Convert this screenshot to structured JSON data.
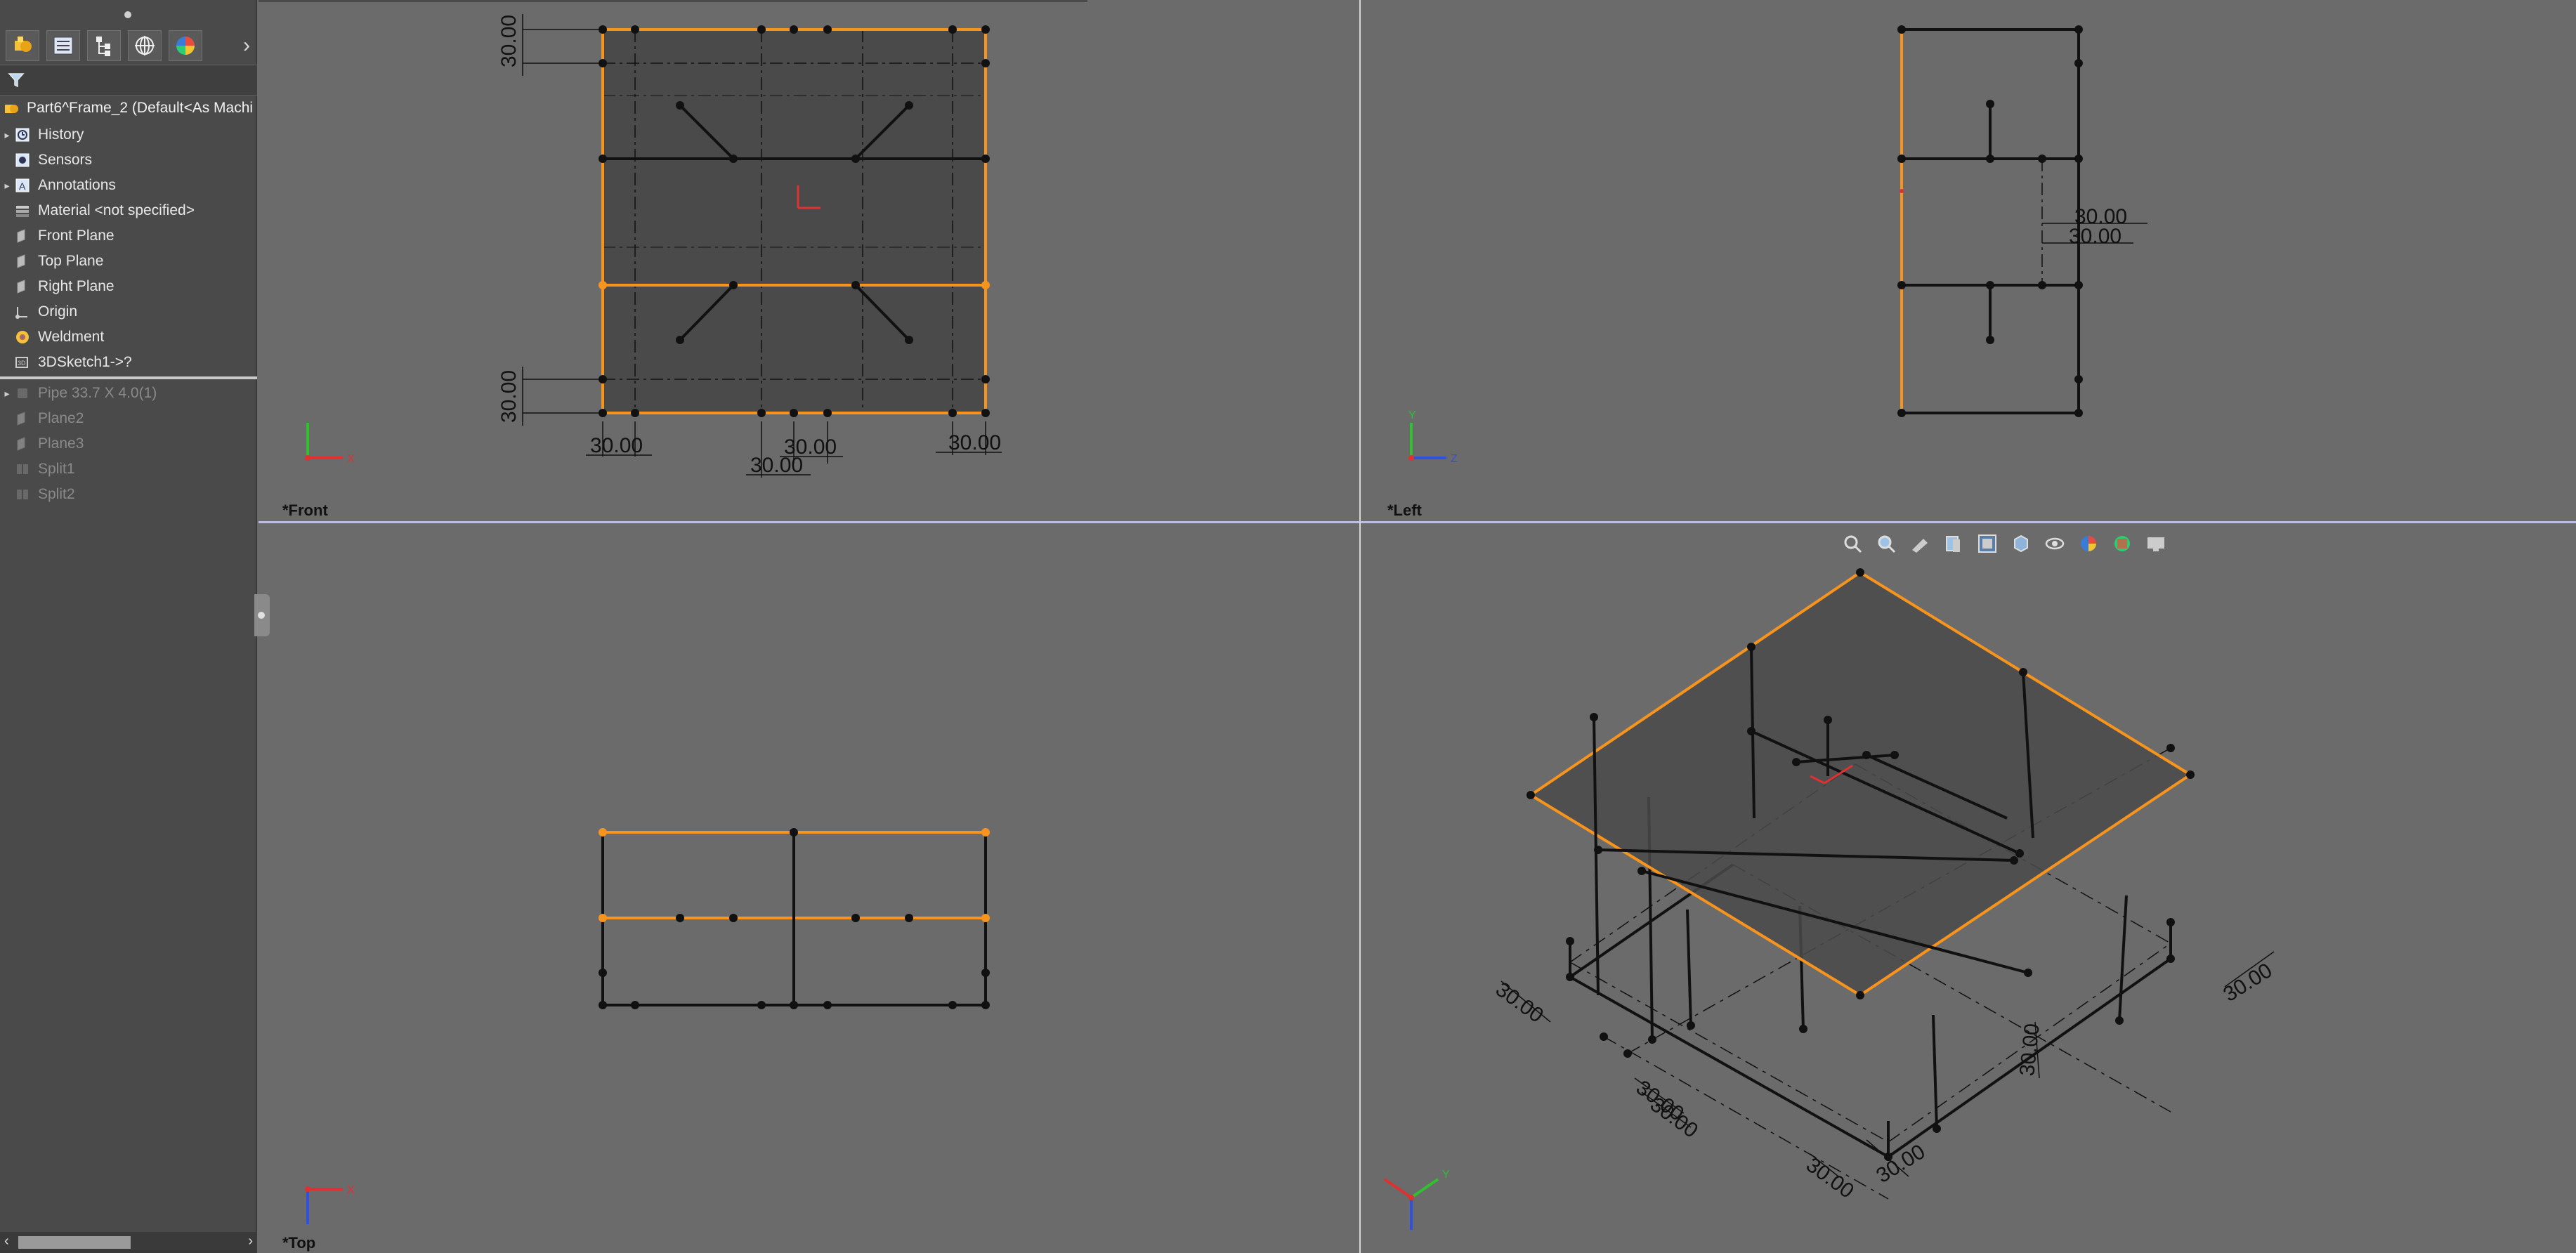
{
  "tree": {
    "root": "Part6^Frame_2  (Default<As Machi",
    "items": [
      {
        "label": "History",
        "expand": true,
        "icon": "history-icon"
      },
      {
        "label": "Sensors",
        "expand": false,
        "icon": "sensors-icon"
      },
      {
        "label": "Annotations",
        "expand": true,
        "icon": "annotations-icon"
      },
      {
        "label": "Material <not specified>",
        "expand": false,
        "icon": "material-icon"
      },
      {
        "label": "Front Plane",
        "expand": false,
        "icon": "plane-icon"
      },
      {
        "label": "Top Plane",
        "expand": false,
        "icon": "plane-icon"
      },
      {
        "label": "Right Plane",
        "expand": false,
        "icon": "plane-icon"
      },
      {
        "label": "Origin",
        "expand": false,
        "icon": "origin-icon"
      },
      {
        "label": "Weldment",
        "expand": false,
        "icon": "weldment-icon"
      },
      {
        "label": "3DSketch1->?",
        "expand": false,
        "icon": "sketch-icon"
      }
    ],
    "suppressed": [
      {
        "label": "Pipe 33.7 X 4.0(1)",
        "expand": true,
        "icon": "pipe-icon"
      },
      {
        "label": "Plane2",
        "expand": false,
        "icon": "plane-icon"
      },
      {
        "label": "Plane3",
        "expand": false,
        "icon": "plane-icon"
      },
      {
        "label": "Split1",
        "expand": false,
        "icon": "split-icon"
      },
      {
        "label": "Split2",
        "expand": false,
        "icon": "split-icon"
      }
    ]
  },
  "tabs": [
    "feature-manager-tab",
    "property-manager-tab",
    "configuration-manager-tab",
    "dimxpert-tab",
    "display-manager-tab"
  ],
  "viewports": {
    "front": {
      "label": "*Front"
    },
    "left": {
      "label": "*Left"
    },
    "top": {
      "label": "*Top"
    },
    "iso": {
      "label": ""
    }
  },
  "dims": {
    "d30": "30.00"
  },
  "axes": {
    "x": "X",
    "y": "Y",
    "z": "Z"
  },
  "colors": {
    "accent_orange": "#f7941d",
    "face_fill": "#4a4a4a",
    "background": "#6b6b6b"
  }
}
